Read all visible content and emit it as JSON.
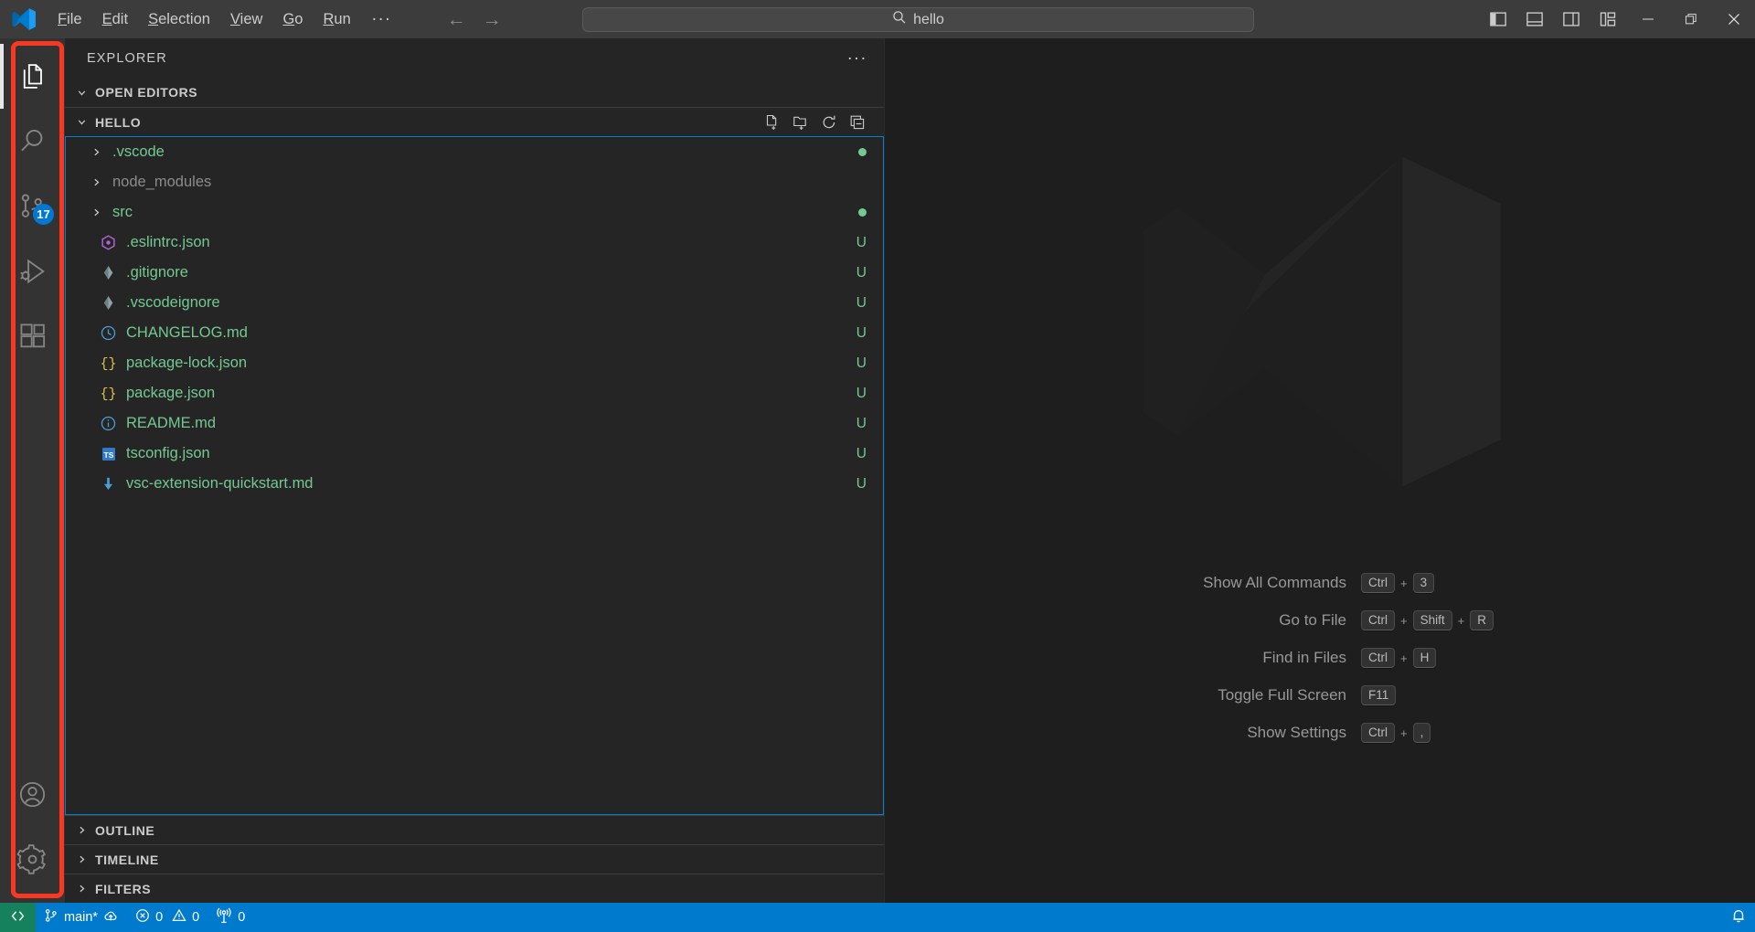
{
  "window": {
    "app_logo_icon": "vscode-logo-icon",
    "menus": [
      {
        "label": "File",
        "mnemonic": "F"
      },
      {
        "label": "Edit",
        "mnemonic": "E"
      },
      {
        "label": "Selection",
        "mnemonic": "S"
      },
      {
        "label": "View",
        "mnemonic": "V"
      },
      {
        "label": "Go",
        "mnemonic": "G"
      },
      {
        "label": "Run",
        "mnemonic": "R"
      }
    ],
    "menu_overflow_label": "...",
    "nav_back_icon": "arrow-left-icon",
    "nav_forward_icon": "arrow-right-icon",
    "command_center": {
      "search_icon": "search-icon",
      "value": "hello",
      "placeholder": "Search"
    },
    "layout_controls": [
      {
        "name": "toggle-primary-sidebar",
        "icon": "layout-sidebar-left-icon"
      },
      {
        "name": "toggle-panel",
        "icon": "layout-panel-bottom-icon"
      },
      {
        "name": "toggle-secondary-sidebar",
        "icon": "layout-sidebar-right-icon"
      },
      {
        "name": "customize-layout",
        "icon": "layout-customize-icon"
      }
    ],
    "window_controls": [
      {
        "name": "minimize-window",
        "icon": "minimize-icon",
        "label": "—"
      },
      {
        "name": "restore-window",
        "icon": "restore-icon",
        "label": "❐"
      },
      {
        "name": "close-window",
        "icon": "close-icon",
        "label": "✕"
      }
    ]
  },
  "activity_bar": {
    "highlight_color": "#f93822",
    "items": [
      {
        "name": "explorer",
        "icon": "files-icon",
        "label": "Explorer",
        "active": true,
        "badge": ""
      },
      {
        "name": "search",
        "icon": "search-icon",
        "label": "Search",
        "active": false,
        "badge": ""
      },
      {
        "name": "source-control",
        "icon": "source-control-icon",
        "label": "Source Control",
        "active": false,
        "badge": "17"
      },
      {
        "name": "run-and-debug",
        "icon": "run-debug-icon",
        "label": "Run and Debug",
        "active": false,
        "badge": ""
      },
      {
        "name": "extensions",
        "icon": "extensions-icon",
        "label": "Extensions",
        "active": false,
        "badge": ""
      }
    ],
    "bottom_items": [
      {
        "name": "accounts",
        "icon": "account-icon",
        "label": "Accounts"
      },
      {
        "name": "settings",
        "icon": "gear-icon",
        "label": "Manage"
      }
    ]
  },
  "sidebar": {
    "title": "EXPLORER",
    "more_actions_label": "...",
    "sections": [
      {
        "name": "open-editors",
        "label": "OPEN EDITORS",
        "expanded": true
      },
      {
        "name": "folder-hello",
        "label": "HELLO",
        "expanded": true
      }
    ],
    "folder_actions": [
      {
        "name": "new-file",
        "icon": "new-file-icon",
        "label": "New File..."
      },
      {
        "name": "new-folder",
        "icon": "new-folder-icon",
        "label": "New Folder..."
      },
      {
        "name": "refresh",
        "icon": "refresh-icon",
        "label": "Refresh Explorer"
      },
      {
        "name": "collapse-all",
        "icon": "collapse-all-icon",
        "label": "Collapse Folders in Explorer"
      }
    ],
    "tree": [
      {
        "name": ".vscode",
        "type": "folder",
        "icon": "folder-icon",
        "color": "#73c991",
        "status": "",
        "status_dot": "#73c991",
        "expanded": false
      },
      {
        "name": "node_modules",
        "type": "folder",
        "icon": "folder-icon",
        "color": "#8c8c8c",
        "status": "",
        "status_dot": "",
        "expanded": false
      },
      {
        "name": "src",
        "type": "folder",
        "icon": "folder-icon",
        "color": "#73c991",
        "status": "",
        "status_dot": "#73c991",
        "expanded": false
      },
      {
        "name": ".eslintrc.json",
        "type": "file",
        "icon": "eslint-icon",
        "color": "#73c991",
        "status": "U",
        "status_dot": ""
      },
      {
        "name": ".gitignore",
        "type": "file",
        "icon": "git-icon",
        "color": "#73c991",
        "status": "U",
        "status_dot": ""
      },
      {
        "name": ".vscodeignore",
        "type": "file",
        "icon": "git-icon",
        "color": "#73c991",
        "status": "U",
        "status_dot": ""
      },
      {
        "name": "CHANGELOG.md",
        "type": "file",
        "icon": "changelog-icon",
        "color": "#73c991",
        "status": "U",
        "status_dot": ""
      },
      {
        "name": "package-lock.json",
        "type": "file",
        "icon": "json-icon",
        "color": "#73c991",
        "status": "U",
        "status_dot": ""
      },
      {
        "name": "package.json",
        "type": "file",
        "icon": "json-icon",
        "color": "#73c991",
        "status": "U",
        "status_dot": ""
      },
      {
        "name": "README.md",
        "type": "file",
        "icon": "readme-info-icon",
        "color": "#73c991",
        "status": "U",
        "status_dot": ""
      },
      {
        "name": "tsconfig.json",
        "type": "file",
        "icon": "typescript-icon",
        "color": "#73c991",
        "status": "U",
        "status_dot": ""
      },
      {
        "name": "vsc-extension-quickstart.md",
        "type": "file",
        "icon": "download-arrow-icon",
        "color": "#73c991",
        "status": "U",
        "status_dot": ""
      }
    ],
    "bottom_sections": [
      {
        "name": "outline",
        "label": "OUTLINE",
        "expanded": false
      },
      {
        "name": "timeline",
        "label": "TIMELINE",
        "expanded": false
      },
      {
        "name": "filters",
        "label": "FILTERS",
        "expanded": false
      }
    ]
  },
  "editor": {
    "watermark_logo_icon": "vscode-logo-watermark-icon",
    "shortcuts": [
      {
        "label": "Show All Commands",
        "keys": [
          "Ctrl",
          "3"
        ]
      },
      {
        "label": "Go to File",
        "keys": [
          "Ctrl",
          "Shift",
          "R"
        ]
      },
      {
        "label": "Find in Files",
        "keys": [
          "Ctrl",
          "H"
        ]
      },
      {
        "label": "Toggle Full Screen",
        "keys": [
          "F11"
        ]
      },
      {
        "label": "Show Settings",
        "keys": [
          "Ctrl",
          ","
        ]
      }
    ]
  },
  "status_bar": {
    "background": "#007acc",
    "remote": {
      "icon": "remote-indicator-icon",
      "label": "",
      "background": "#16825d"
    },
    "branch": {
      "icon": "git-branch-icon",
      "label": "main*",
      "sync_icon": "cloud-upload-icon"
    },
    "problems": {
      "error_icon": "error-circle-icon",
      "errors": "0",
      "warning_icon": "warning-triangle-icon",
      "warnings": "0"
    },
    "ports": {
      "icon": "radio-tower-icon",
      "count": "0"
    },
    "notifications": {
      "icon": "bell-icon"
    }
  }
}
